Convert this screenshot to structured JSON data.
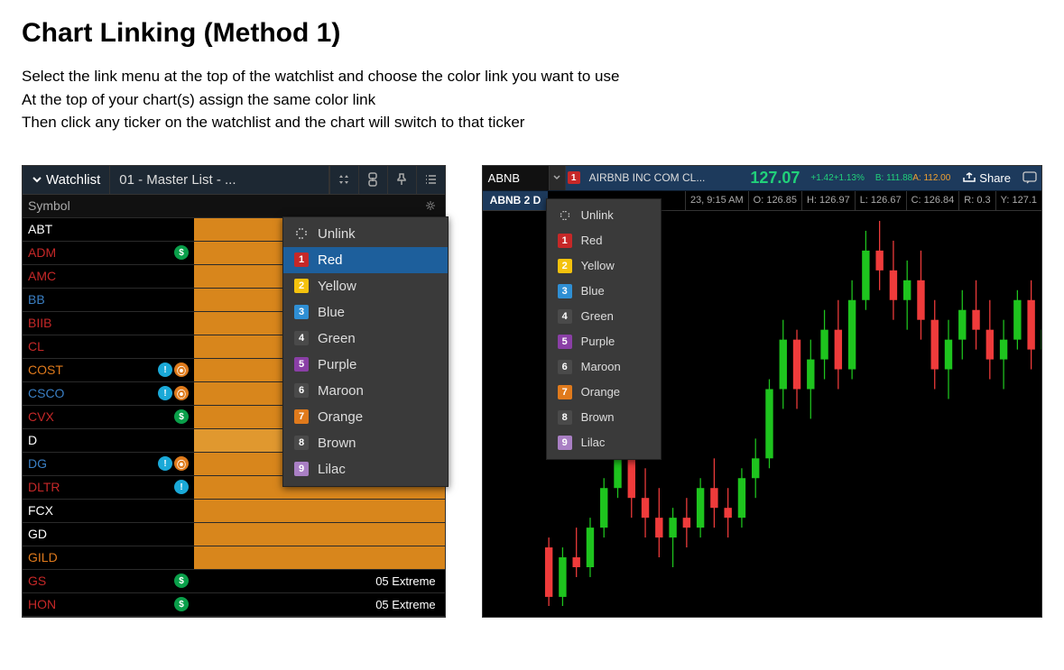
{
  "heading": "Chart Linking (Method 1)",
  "instructions": [
    "Select the link menu at the top of the watchlist and choose the color link you want to use",
    "At the top of your chart(s) assign the same color link",
    "Then click any ticker on the watchlist and the chart will switch to that ticker"
  ],
  "watchlist": {
    "tab_label": "Watchlist",
    "list_name": "01 - Master List - ...",
    "header_symbol": "Symbol",
    "rows": [
      {
        "symbol": "ABT",
        "c2bg": "#d8861c",
        "c2text": "",
        "color": "#ffffff",
        "badges": []
      },
      {
        "symbol": "ADM",
        "c2bg": "#d8861c",
        "c2text": "",
        "color": "#c62828",
        "badges": [
          "green"
        ]
      },
      {
        "symbol": "AMC",
        "c2bg": "#d8861c",
        "c2text": "",
        "color": "#c62828",
        "badges": []
      },
      {
        "symbol": "BB",
        "c2bg": "#d8861c",
        "c2text": "",
        "color": "#3a7fc4",
        "badges": []
      },
      {
        "symbol": "BIIB",
        "c2bg": "#d8861c",
        "c2text": "",
        "color": "#c62828",
        "badges": []
      },
      {
        "symbol": "CL",
        "c2bg": "#d8861c",
        "c2text": "",
        "color": "#c62828",
        "badges": []
      },
      {
        "symbol": "COST",
        "c2bg": "#d8861c",
        "c2text": "",
        "color": "#e07a1c",
        "badges": [
          "cyan",
          "orange"
        ]
      },
      {
        "symbol": "CSCO",
        "c2bg": "#d8861c",
        "c2text": "",
        "color": "#3a7fc4",
        "badges": [
          "cyan",
          "orange"
        ]
      },
      {
        "symbol": "CVX",
        "c2bg": "#d8861c",
        "c2text": "",
        "color": "#c62828",
        "badges": [
          "green"
        ]
      },
      {
        "symbol": "D",
        "c2bg": "#e0982f",
        "c2text": "",
        "color": "#ffffff",
        "badges": []
      },
      {
        "symbol": "DG",
        "c2bg": "#d8861c",
        "c2text": "",
        "color": "#3a7fc4",
        "badges": [
          "cyan",
          "orange"
        ]
      },
      {
        "symbol": "DLTR",
        "c2bg": "#d8861c",
        "c2text": "",
        "color": "#c62828",
        "badges": [
          "cyan"
        ]
      },
      {
        "symbol": "FCX",
        "c2bg": "#d8861c",
        "c2text": "",
        "color": "#ffffff",
        "badges": []
      },
      {
        "symbol": "GD",
        "c2bg": "#d8861c",
        "c2text": "",
        "color": "#ffffff",
        "badges": []
      },
      {
        "symbol": "GILD",
        "c2bg": "#d8861c",
        "c2text": "",
        "color": "#e07a1c",
        "badges": []
      },
      {
        "symbol": "GS",
        "c2bg": "#000000",
        "c2text": "05 Extreme",
        "color": "#c62828",
        "badges": [
          "green"
        ]
      },
      {
        "symbol": "HON",
        "c2bg": "#000000",
        "c2text": "05 Extreme",
        "color": "#c62828",
        "badges": [
          "green"
        ]
      }
    ]
  },
  "link_colors": [
    {
      "label": "Red",
      "num": "1",
      "bg": "#c62828"
    },
    {
      "label": "Yellow",
      "num": "2",
      "bg": "#f4c20d"
    },
    {
      "label": "Blue",
      "num": "3",
      "bg": "#2f8fd4"
    },
    {
      "label": "Green",
      "num": "4",
      "bg": "#4a4a4a"
    },
    {
      "label": "Purple",
      "num": "5",
      "bg": "#8a3fa6"
    },
    {
      "label": "Maroon",
      "num": "6",
      "bg": "#4a4a4a"
    },
    {
      "label": "Orange",
      "num": "7",
      "bg": "#e07a1c"
    },
    {
      "label": "Brown",
      "num": "8",
      "bg": "#4a4a4a"
    },
    {
      "label": "Lilac",
      "num": "9",
      "bg": "#a97fc4"
    }
  ],
  "unlink_label": "Unlink",
  "chart": {
    "ticker": "ABNB",
    "company": "AIRBNB INC COM CL...",
    "price": "127.07",
    "delta_abs": "+1.42",
    "delta_pct": "+1.13%",
    "bid": "B: 111.88",
    "ask": "A: 112.00",
    "share_label": "Share",
    "timeframe": "ABNB 2 D",
    "ohlc": {
      "time": "23, 9:15 AM",
      "o": "O: 126.85",
      "h": "H: 126.97",
      "l": "L: 126.67",
      "c": "C: 126.84",
      "r": "R: 0.3",
      "y": "Y: 127.1"
    }
  },
  "chart_data": {
    "type": "candlestick",
    "title": "ABNB 2 D",
    "ylim": [
      95,
      135
    ],
    "candles": [
      {
        "o": 101,
        "h": 102,
        "l": 95,
        "c": 96
      },
      {
        "o": 96,
        "h": 101,
        "l": 95,
        "c": 100
      },
      {
        "o": 100,
        "h": 103,
        "l": 98,
        "c": 99
      },
      {
        "o": 99,
        "h": 104,
        "l": 98,
        "c": 103
      },
      {
        "o": 103,
        "h": 108,
        "l": 102,
        "c": 107
      },
      {
        "o": 107,
        "h": 115,
        "l": 106,
        "c": 113
      },
      {
        "o": 113,
        "h": 114,
        "l": 104,
        "c": 106
      },
      {
        "o": 106,
        "h": 109,
        "l": 102,
        "c": 104
      },
      {
        "o": 104,
        "h": 107,
        "l": 100,
        "c": 102
      },
      {
        "o": 102,
        "h": 105,
        "l": 99,
        "c": 104
      },
      {
        "o": 104,
        "h": 106,
        "l": 101,
        "c": 103
      },
      {
        "o": 103,
        "h": 108,
        "l": 102,
        "c": 107
      },
      {
        "o": 107,
        "h": 110,
        "l": 103,
        "c": 105
      },
      {
        "o": 105,
        "h": 107,
        "l": 102,
        "c": 104
      },
      {
        "o": 104,
        "h": 109,
        "l": 103,
        "c": 108
      },
      {
        "o": 108,
        "h": 112,
        "l": 106,
        "c": 110
      },
      {
        "o": 110,
        "h": 118,
        "l": 109,
        "c": 117
      },
      {
        "o": 117,
        "h": 124,
        "l": 115,
        "c": 122
      },
      {
        "o": 122,
        "h": 123,
        "l": 115,
        "c": 117
      },
      {
        "o": 117,
        "h": 122,
        "l": 114,
        "c": 120
      },
      {
        "o": 120,
        "h": 125,
        "l": 118,
        "c": 123
      },
      {
        "o": 123,
        "h": 126,
        "l": 117,
        "c": 119
      },
      {
        "o": 119,
        "h": 128,
        "l": 118,
        "c": 126
      },
      {
        "o": 126,
        "h": 133,
        "l": 125,
        "c": 131
      },
      {
        "o": 131,
        "h": 134,
        "l": 127,
        "c": 129
      },
      {
        "o": 129,
        "h": 132,
        "l": 124,
        "c": 126
      },
      {
        "o": 126,
        "h": 130,
        "l": 123,
        "c": 128
      },
      {
        "o": 128,
        "h": 131,
        "l": 122,
        "c": 124
      },
      {
        "o": 124,
        "h": 126,
        "l": 117,
        "c": 119
      },
      {
        "o": 119,
        "h": 124,
        "l": 116,
        "c": 122
      },
      {
        "o": 122,
        "h": 127,
        "l": 120,
        "c": 125
      },
      {
        "o": 125,
        "h": 128,
        "l": 121,
        "c": 123
      },
      {
        "o": 123,
        "h": 126,
        "l": 118,
        "c": 120
      },
      {
        "o": 120,
        "h": 124,
        "l": 117,
        "c": 122
      },
      {
        "o": 122,
        "h": 127,
        "l": 121,
        "c": 126
      },
      {
        "o": 126,
        "h": 128,
        "l": 119,
        "c": 121
      },
      {
        "o": 121,
        "h": 125,
        "l": 118,
        "c": 123
      },
      {
        "o": 123,
        "h": 127,
        "l": 121,
        "c": 125
      }
    ]
  }
}
